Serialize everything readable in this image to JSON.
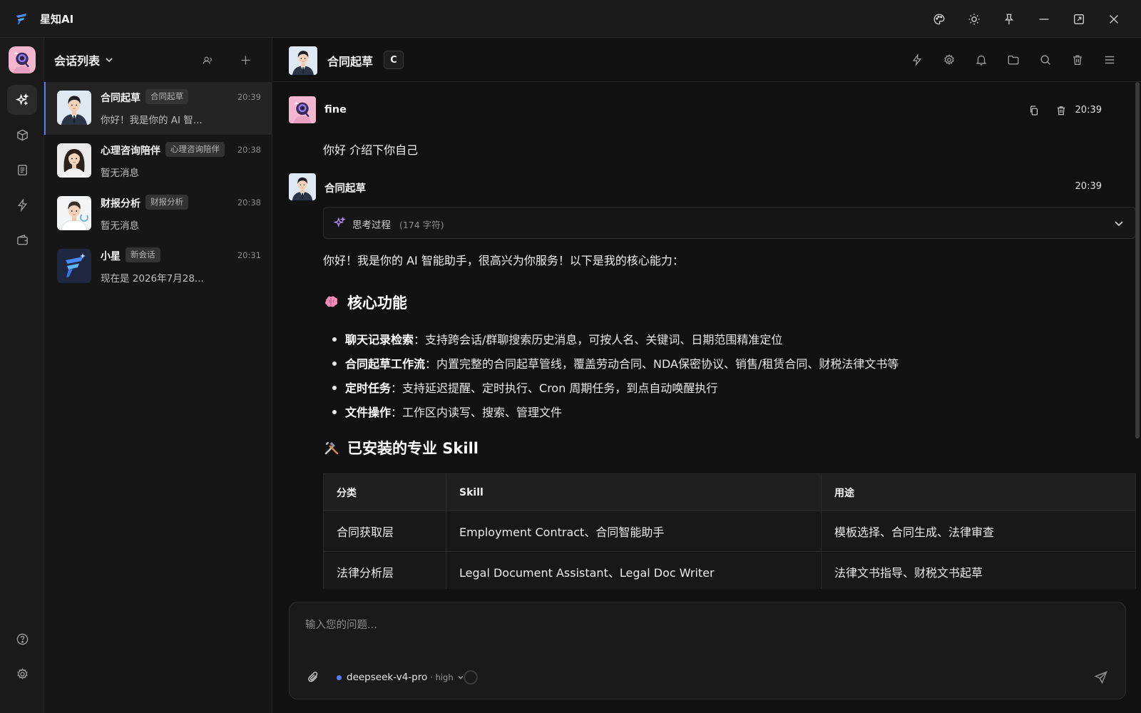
{
  "app": {
    "title": "星知AI",
    "icon": "app-logo"
  },
  "titlebar": {
    "buttons": [
      {
        "icon": "palette-icon",
        "name": "theme-palette"
      },
      {
        "icon": "sun-icon",
        "name": "light-mode"
      },
      {
        "icon": "pin-icon",
        "name": "pin-window"
      },
      {
        "icon": "minimize-icon",
        "name": "minimize"
      },
      {
        "icon": "restore-icon",
        "name": "maximize"
      },
      {
        "icon": "close-icon",
        "name": "close"
      }
    ]
  },
  "rail": {
    "items": [
      {
        "icon": "sparkle-icon",
        "name": "ai-chat",
        "active": true
      },
      {
        "icon": "cube-icon",
        "name": "models",
        "active": false
      },
      {
        "icon": "document-icon",
        "name": "documents",
        "active": false
      },
      {
        "icon": "lightning-icon",
        "name": "quick-actions",
        "active": false
      },
      {
        "icon": "wallet-icon",
        "name": "wallet",
        "active": false
      }
    ],
    "bottom": [
      {
        "icon": "help-icon",
        "name": "help"
      },
      {
        "icon": "gear-icon",
        "name": "settings"
      }
    ]
  },
  "conversations": {
    "title": "会话列表",
    "items": [
      {
        "name": "合同起草",
        "tag": "合同起草",
        "time": "20:39",
        "preview": "你好！我是你的 AI 智...",
        "active": true,
        "avatar": "man-suit"
      },
      {
        "name": "心理咨询陪伴",
        "tag": "心理咨询陪伴",
        "time": "20:38",
        "preview": "暂无消息",
        "active": false,
        "avatar": "woman"
      },
      {
        "name": "财报分析",
        "tag": "财报分析",
        "time": "20:38",
        "preview": "暂无消息",
        "active": false,
        "avatar": "man-casual"
      },
      {
        "name": "小星",
        "tag": "新会话",
        "time": "20:31",
        "preview": "现在是 2026年7月28...",
        "active": false,
        "avatar": "app-logo"
      }
    ]
  },
  "chat": {
    "title": "合同起草",
    "badge": "C",
    "toolbar": [
      {
        "icon": "lightning-icon",
        "name": "quick-actions"
      },
      {
        "icon": "gear-icon",
        "name": "settings"
      },
      {
        "icon": "bell-icon",
        "name": "notifications"
      },
      {
        "icon": "folder-icon",
        "name": "files"
      },
      {
        "icon": "search-icon",
        "name": "search"
      },
      {
        "icon": "trash-icon",
        "name": "delete"
      },
      {
        "icon": "menu-icon",
        "name": "menu"
      }
    ],
    "user_message": {
      "author": "fine",
      "time": "20:39",
      "text": "你好 介绍下你自己"
    },
    "assistant_message": {
      "author": "合同起草",
      "time": "20:39",
      "thinking": {
        "label": "思考过程",
        "count": "(174 字符)"
      },
      "intro": "你好！我是你的 AI 智能助手，很高兴为你服务！以下是我的核心能力：",
      "section1": {
        "emoji": "brain-icon",
        "title": "核心功能"
      },
      "bullets": [
        {
          "bold": "聊天记录检索",
          "text": "：支持跨会话/群聊搜索历史消息，可按人名、关键词、日期范围精准定位"
        },
        {
          "bold": "合同起草工作流",
          "text": "：内置完整的合同起草管线，覆盖劳动合同、NDA保密协议、销售/租赁合同、财税法律文书等"
        },
        {
          "bold": "定时任务",
          "text": "：支持延迟提醒、定时执行、Cron 周期任务，到点自动唤醒执行"
        },
        {
          "bold": "文件操作",
          "text": "：工作区内读写、搜索、管理文件"
        }
      ],
      "section2": {
        "emoji": "tools-icon",
        "title": "已安装的专业 Skill"
      },
      "table": {
        "headers": [
          "分类",
          "Skill",
          "用途"
        ],
        "rows": [
          [
            "合同获取层",
            "Employment Contract、合同智能助手",
            "模板选择、合同生成、法律审查"
          ],
          [
            "法律分析层",
            "Legal Document Assistant、Legal Doc Writer",
            "法律文书指导、财税文书起草"
          ]
        ]
      }
    }
  },
  "composer": {
    "placeholder": "输入您的问题...",
    "model": "deepseek-v4-pro",
    "level": "· high",
    "accent": "#5b7cf7"
  }
}
